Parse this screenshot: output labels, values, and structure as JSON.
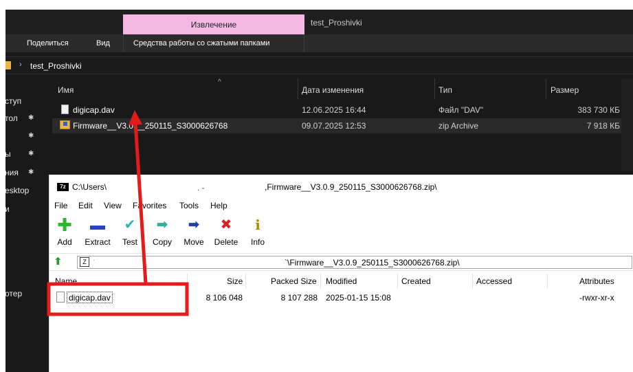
{
  "explorer": {
    "ribbon": {
      "active_tab": "Извлечение",
      "window_title": "test_Proshivki",
      "menu": [
        "Поделиться",
        "Вид",
        "Средства работы со сжатыми папками"
      ]
    },
    "address": {
      "path": "test_Proshivki"
    },
    "nav_items": [
      "ступ",
      "тол",
      "ы",
      "ния",
      "esktop",
      "и",
      "отер"
    ],
    "columns": {
      "name": "Имя",
      "modified": "Дата изменения",
      "type": "Тип",
      "size": "Размер"
    },
    "files": [
      {
        "name": "digicap.dav",
        "modified": "12.06.2025 16:44",
        "type": "Файл \"DAV\"",
        "size": "383 730 КБ"
      },
      {
        "name": "Firmware__V3.0.__250115_S3000626768",
        "modified": "09.07.2025 12:53",
        "type": "zip Archive",
        "size": "7 918 КБ"
      }
    ]
  },
  "sevenzip": {
    "title_left": "C:\\Users\\",
    "title_dots": ". -",
    "title_right": ",Firmware__V3.0.9_250115_S3000626768.zip\\",
    "menu": [
      "File",
      "Edit",
      "View",
      "Favorites",
      "Tools",
      "Help"
    ],
    "toolbar": [
      {
        "label": "Add",
        "icon": "plus-icon",
        "color": "#2fb52f"
      },
      {
        "label": "Extract",
        "icon": "minus-icon",
        "color": "#2a45c4"
      },
      {
        "label": "Test",
        "icon": "check-icon",
        "color": "#2db3b3"
      },
      {
        "label": "Copy",
        "icon": "copy-arrow-icon",
        "color": "#2fae9a"
      },
      {
        "label": "Move",
        "icon": "move-arrow-icon",
        "color": "#1f3fa8"
      },
      {
        "label": "Delete",
        "icon": "delete-x-icon",
        "color": "#d42424"
      },
      {
        "label": "Info",
        "icon": "info-icon",
        "color": "#b38a00"
      }
    ],
    "address_path": "`\\Firmware__V3.0.9_250115_S3000626768.zip\\",
    "columns": {
      "name": "Name",
      "size": "Size",
      "packed": "Packed Size",
      "modified": "Modified",
      "created": "Created",
      "accessed": "Accessed",
      "attributes": "Attributes"
    },
    "rows": [
      {
        "name": "digicap.dav",
        "size": "8 106 048",
        "packed": "8 107 288",
        "modified": "2025-01-15 15:08",
        "created": "",
        "accessed": "",
        "attributes": "-rwxr-xr-x"
      }
    ]
  },
  "colors": {
    "explorer_bg": "#191919",
    "extract_tab": "#f5b8e4",
    "annotation_red": "#e31b1b"
  }
}
